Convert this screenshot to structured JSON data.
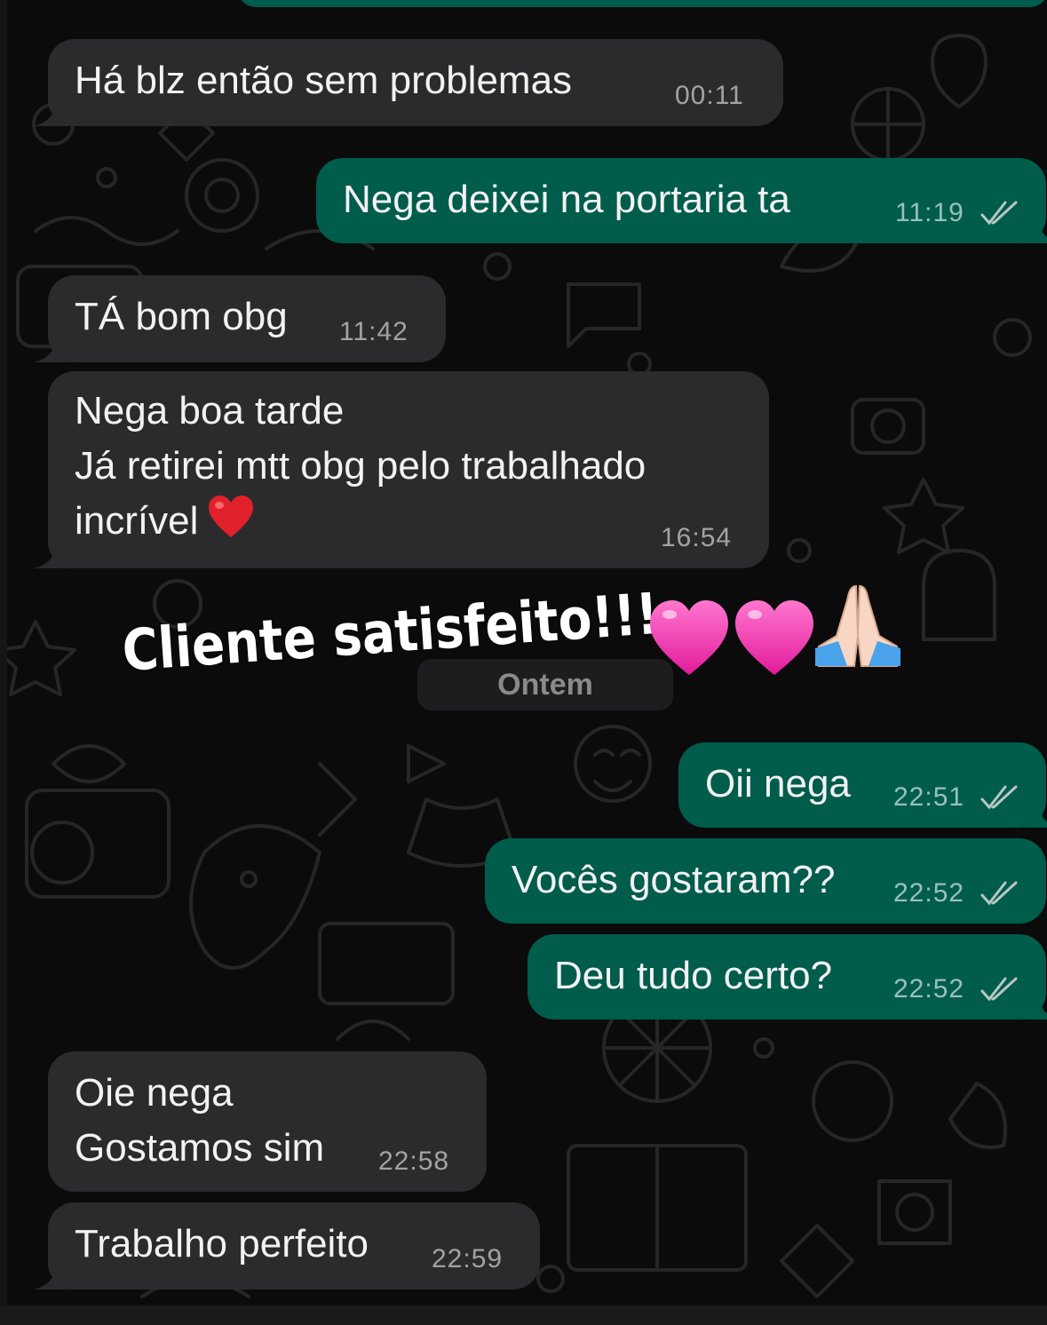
{
  "chat": {
    "messages": [
      {
        "id": "m1",
        "direction": "in",
        "text": "Há blz então sem problemas",
        "time": "00:11"
      },
      {
        "id": "m2",
        "direction": "out",
        "text": "Nega deixei na portaria ta",
        "time": "11:19",
        "status": "read"
      },
      {
        "id": "m3",
        "direction": "in",
        "text": "TÁ bom obg",
        "time": "11:42"
      },
      {
        "id": "m4",
        "direction": "in",
        "text_lines": [
          "Nega boa tarde",
          "Já retirei mtt obg pelo trabalhado",
          "incrível"
        ],
        "emoji": "red-heart",
        "time": "16:54"
      },
      {
        "id": "m5",
        "direction": "out",
        "text": "Oii nega",
        "time": "22:51",
        "status": "read"
      },
      {
        "id": "m6",
        "direction": "out",
        "text": "Vocês gostaram??",
        "time": "22:52",
        "status": "read"
      },
      {
        "id": "m7",
        "direction": "out",
        "text": "Deu tudo certo?",
        "time": "22:52",
        "status": "read"
      },
      {
        "id": "m8",
        "direction": "in",
        "text_lines": [
          "Oie nega",
          "Gostamos sim"
        ],
        "time": "22:58"
      },
      {
        "id": "m9",
        "direction": "in",
        "text": "Trabalho perfeito",
        "time": "22:59"
      }
    ],
    "day_separator": "Ontem"
  },
  "overlay": {
    "caption": "Cliente satisfeito!!!",
    "emojis": [
      "pink-heart",
      "pink-heart",
      "folded-hands"
    ]
  },
  "colors": {
    "background": "#0b0b0b",
    "incoming_bubble": "#2b2b2d",
    "outgoing_bubble": "#005c4b",
    "read_tick": "#b9c7c3",
    "red_heart": "#e0202a",
    "pink_heart": "#ff3fb4"
  }
}
